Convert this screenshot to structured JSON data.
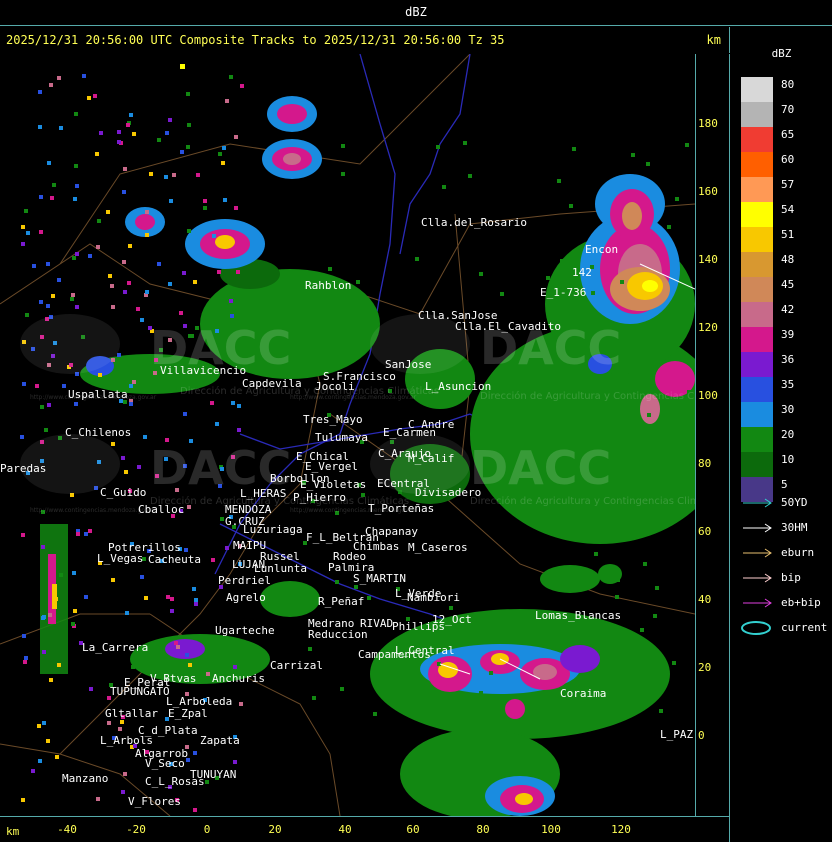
{
  "window": {
    "title": "dBZ"
  },
  "header": {
    "title": "2025/12/31 20:56:00 UTC Composite Tracks to 2025/12/31 20:56:00 Tz 35",
    "unit": "km"
  },
  "axes": {
    "x_label": "km",
    "x_ticks": [
      "-40",
      "-20",
      "0",
      "20",
      "40",
      "60",
      "80",
      "100",
      "120"
    ],
    "y_ticks": [
      "180",
      "160",
      "140",
      "120",
      "100",
      "80",
      "60",
      "40",
      "20",
      "0"
    ]
  },
  "legend": {
    "title": "dBZ",
    "levels": [
      {
        "label": "80",
        "color": "#d8d8d8"
      },
      {
        "label": "70",
        "color": "#b4b4b4"
      },
      {
        "label": "65",
        "color": "#f03c32"
      },
      {
        "label": "60",
        "color": "#ff5f00"
      },
      {
        "label": "57",
        "color": "#ff9955"
      },
      {
        "label": "54",
        "color": "#ffff00"
      },
      {
        "label": "51",
        "color": "#f8c800"
      },
      {
        "label": "48",
        "color": "#d89830"
      },
      {
        "label": "45",
        "color": "#d08858"
      },
      {
        "label": "42",
        "color": "#c86a8a"
      },
      {
        "label": "39",
        "color": "#d4188c"
      },
      {
        "label": "36",
        "color": "#7a1ad0"
      },
      {
        "label": "35",
        "color": "#2850e0"
      },
      {
        "label": "30",
        "color": "#1a8ce0"
      },
      {
        "label": "20",
        "color": "#128812"
      },
      {
        "label": "10",
        "color": "#0c6a0c"
      },
      {
        "label": "5",
        "color": "#483888"
      }
    ],
    "tracks": [
      {
        "label": "50YD",
        "color": "#33d0d0"
      },
      {
        "label": "30HM",
        "color": "#ffffff"
      },
      {
        "label": "eburn",
        "color": "#e8c070"
      },
      {
        "label": "bip",
        "color": "#ffd0d0"
      },
      {
        "label": "eb+bip",
        "color": "#e040e0"
      },
      {
        "label": "current",
        "color": "#33d0d0"
      }
    ]
  },
  "watermark": {
    "brand": "DACC",
    "subtitle": "Dirección de Agricultura y Contingencias Climáticas",
    "url": "http://www.contingencias.mendoza.gov.ar"
  },
  "places": [
    "Clla.del_Rosario",
    "Encon",
    "E_1-736",
    "Rahblon",
    "Clla.SanJose",
    "Clla.El_Cavadito",
    "Villavicencio",
    "Capdevila",
    "S.Francisco",
    "Jocoli",
    "SanJose",
    "L_Asuncion",
    "Uspallata",
    "C_Chilenos",
    "Tres_Mayo",
    "Tulumaya",
    "E_Carmen",
    "C_Andre",
    "E_Chical",
    "E_Vergel",
    "C_Araujo",
    "M_Calif",
    "Borbollon",
    "E_Violetas",
    "ECentral",
    "Divisadero",
    "C_Guido",
    "L_HERAS",
    "P_Hierro",
    "T_Porteñas",
    "Cballoc",
    "MENDOZA",
    "G.CRUZ",
    "Luzuriaga",
    "F_L_Beltran",
    "Chapanay",
    "Chimbas",
    "M_Caseros",
    "Potrerillos",
    "L_Vegas",
    "Cacheuta",
    "MAIPU",
    "Russel",
    "LUJAN",
    "Lunlunta",
    "Perdriel",
    "Rodeo",
    "Palmira",
    "S_MARTIN",
    "Agrelo",
    "R_Peñaf",
    "L_Verde",
    "Nambiori",
    "Medrano",
    "RIVAD",
    "Phillips",
    "Ugarteche",
    "12_Oct",
    "Reduccion",
    "Lomas_Blancas",
    "La_Carrera",
    "Carrizal",
    "Campamentos",
    "L_Central",
    "E_Peral",
    "V_Btvas",
    "Anchuris",
    "TUPUNGATO",
    "L_Arboleda",
    "Gltallar",
    "E_Zpal",
    "C_d_Plata",
    "L_Arbols",
    "Zapata",
    "Algarrob",
    "V_Seco",
    "TUNUYAN",
    "Manzano",
    "C_L_Rosas",
    "V_Flores",
    "L_PAZ",
    "Coraima",
    "Paredas",
    "142"
  ]
}
